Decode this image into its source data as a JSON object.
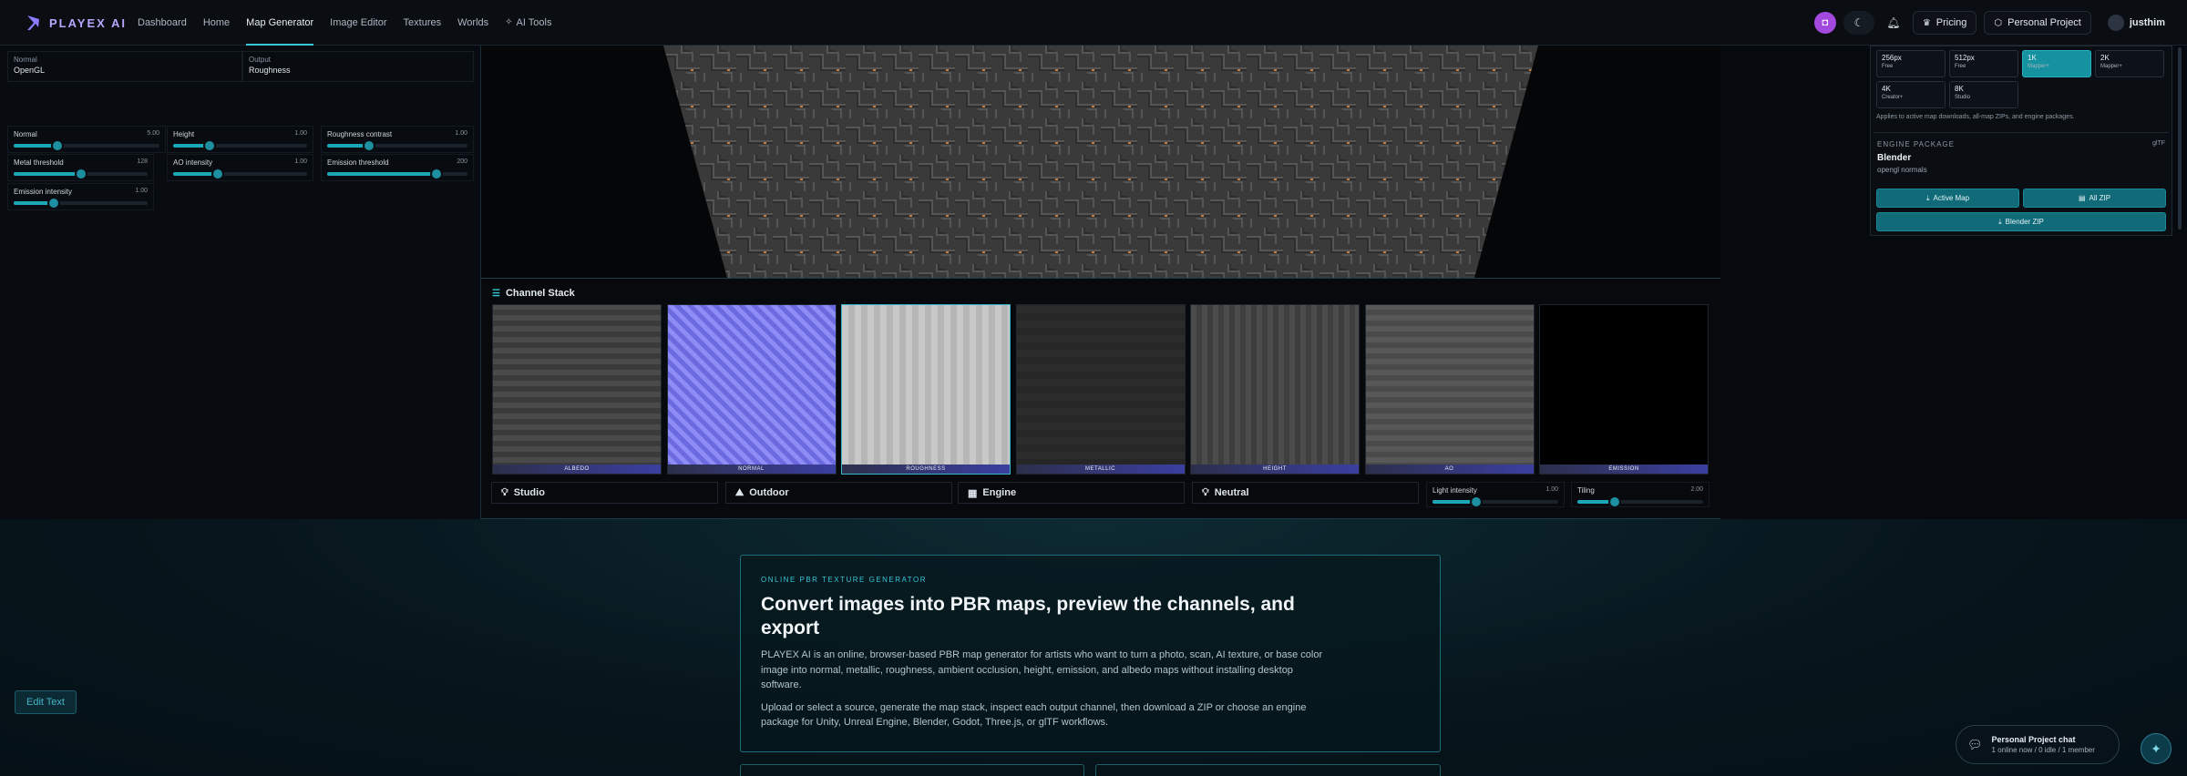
{
  "brand": {
    "name": "PLAYEX AI"
  },
  "nav": {
    "links": [
      "Dashboard",
      "Home",
      "Map Generator",
      "Image Editor",
      "Textures",
      "Worlds",
      "AI Tools"
    ],
    "pricing": "Pricing",
    "project": "Personal Project",
    "user": "justhim"
  },
  "controls": {
    "normal_field": {
      "label": "Normal",
      "value": "OpenGL"
    },
    "output_field": {
      "label": "Output",
      "value": "Roughness"
    },
    "sliders": [
      {
        "label": "Normal",
        "value": "5.00",
        "level": 0.3
      },
      {
        "label": "Height",
        "value": "1.00",
        "level": 0.27
      },
      {
        "label": "Roughness contrast",
        "value": "1.00",
        "level": 0.3
      },
      {
        "label": "Metal threshold",
        "value": "128",
        "level": 0.5
      },
      {
        "label": "AO intensity",
        "value": "1.00",
        "level": 0.33
      },
      {
        "label": "Emission threshold",
        "value": "200",
        "level": 0.78
      },
      {
        "label": "Emission intensity",
        "value": "1.00",
        "level": 0.3
      }
    ]
  },
  "channel_stack": {
    "title": "Channel Stack",
    "channels": [
      "ALBEDO",
      "NORMAL",
      "ROUGHNESS",
      "METALLIC",
      "HEIGHT",
      "AO",
      "EMISSION"
    ]
  },
  "environment": {
    "presets": [
      "Studio",
      "Outdoor",
      "Engine",
      "Neutral"
    ],
    "light_intensity": {
      "label": "Light intensity",
      "value": "1.00",
      "level": 0.35
    },
    "tiling": {
      "label": "Tiling",
      "value": "2.00",
      "level": 0.3
    }
  },
  "export": {
    "resolutions": [
      {
        "size": "256px",
        "tier": "Free"
      },
      {
        "size": "512px",
        "tier": "Free"
      },
      {
        "size": "1K",
        "tier": "Mapper+"
      },
      {
        "size": "2K",
        "tier": "Mapper+"
      },
      {
        "size": "4K",
        "tier": "Creator+"
      },
      {
        "size": "8K",
        "tier": "Studio"
      }
    ],
    "selected": "1K",
    "note": "Applies to active map downloads, all-map ZIPs, and engine packages.",
    "engine_label": "ENGINE PACKAGE",
    "engine_format": "glTF",
    "engine_name": "Blender",
    "engine_sub": "opengl normals",
    "btn_active_map": "Active Map",
    "btn_all_zip": "All ZIP",
    "btn_engine_zip": "Blender ZIP"
  },
  "hero": {
    "eyebrow": "ONLINE PBR TEXTURE GENERATOR",
    "title": "Convert images into PBR maps, preview the channels, and export",
    "p1": "PLAYEX AI is an online, browser-based PBR map generator for artists who want to turn a photo, scan, AI texture, or base color image into normal, metallic, roughness, ambient occlusion, height, emission, and albedo maps without installing desktop software.",
    "p2": "Upload or select a source, generate the map stack, inspect each output channel, then download a ZIP or choose an engine package for Unity, Unreal Engine, Blender, Godot, Three.js, or glTF workflows."
  },
  "edit_text": "Edit Text",
  "chat": {
    "title": "Personal Project chat",
    "status": "1 online now / 0 idle / 1 member"
  },
  "colors": {
    "accent": "#37c5d8",
    "brand": "#b8a6ff",
    "selected": "#1591a0"
  }
}
